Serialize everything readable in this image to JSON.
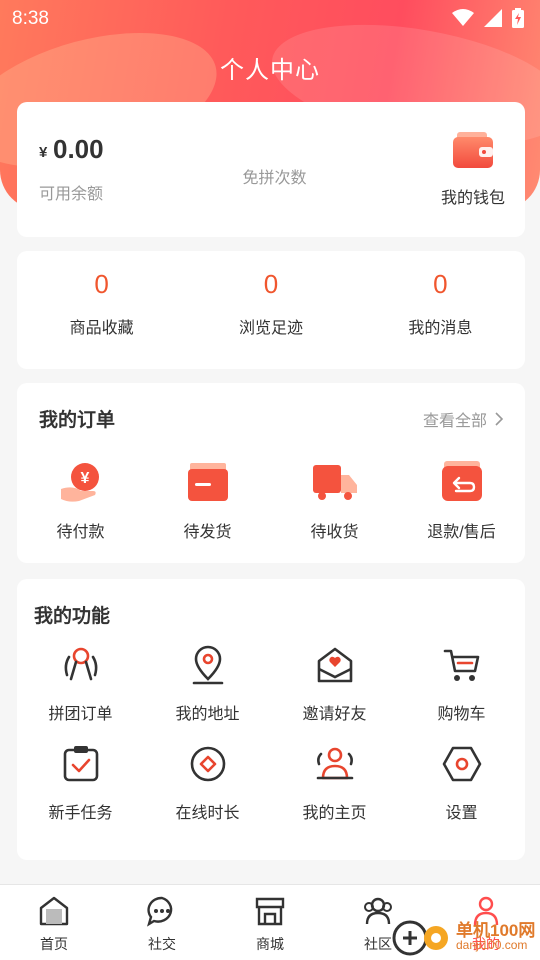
{
  "status_bar": {
    "time": "8:38"
  },
  "header": {
    "title": "个人中心"
  },
  "wallet": {
    "currency_symbol": "¥",
    "balance": "0.00",
    "balance_label": "可用余额",
    "free_group_label": "免拼次数",
    "wallet_label": "我的钱包"
  },
  "stats": [
    {
      "value": "0",
      "label": "商品收藏"
    },
    {
      "value": "0",
      "label": "浏览足迹"
    },
    {
      "value": "0",
      "label": "我的消息"
    }
  ],
  "orders": {
    "title": "我的订单",
    "view_all": "查看全部",
    "items": [
      {
        "label": "待付款",
        "icon": "pending-payment-icon"
      },
      {
        "label": "待发货",
        "icon": "pending-shipment-icon"
      },
      {
        "label": "待收货",
        "icon": "delivery-truck-icon"
      },
      {
        "label": "退款/售后",
        "icon": "refund-icon"
      }
    ]
  },
  "functions": {
    "title": "我的功能",
    "items": [
      {
        "label": "拼团订单",
        "icon": "group-order-icon"
      },
      {
        "label": "我的地址",
        "icon": "location-pin-icon"
      },
      {
        "label": "邀请好友",
        "icon": "invite-envelope-icon"
      },
      {
        "label": "购物车",
        "icon": "shopping-cart-icon"
      },
      {
        "label": "新手任务",
        "icon": "clipboard-check-icon"
      },
      {
        "label": "在线时长",
        "icon": "diamond-icon"
      },
      {
        "label": "我的主页",
        "icon": "user-group-icon"
      },
      {
        "label": "设置",
        "icon": "settings-hexagon-icon"
      }
    ]
  },
  "tabbar": [
    {
      "label": "首页",
      "icon": "home-icon"
    },
    {
      "label": "社交",
      "icon": "chat-bubble-icon"
    },
    {
      "label": "商城",
      "icon": "store-icon"
    },
    {
      "label": "社区",
      "icon": "community-icon"
    },
    {
      "label": "我的",
      "icon": "profile-icon",
      "active": true
    }
  ],
  "watermark": {
    "name": "单机100网",
    "url": "danji100.com"
  },
  "colors": {
    "accent": "#f0562e",
    "header": "#ff5a5a",
    "active_tab": "#ff4d4d"
  }
}
